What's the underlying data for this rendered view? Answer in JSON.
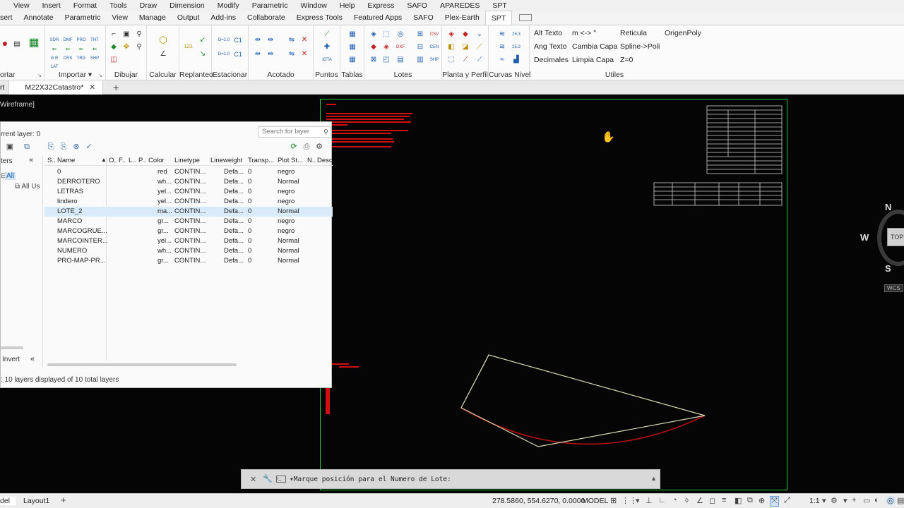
{
  "menubar": [
    "View",
    "Insert",
    "Format",
    "Tools",
    "Draw",
    "Dimension",
    "Modify",
    "Parametric",
    "Window",
    "Help",
    "Express",
    "SAFO",
    "APAREDES",
    "SPT"
  ],
  "ribbon_tabs": [
    "sert",
    "Annotate",
    "Parametric",
    "View",
    "Manage",
    "Output",
    "Add-ins",
    "Collaborate",
    "Express Tools",
    "Featured Apps",
    "SAFO",
    "Plex-Earth",
    "SPT"
  ],
  "ribbon_active_tab": "SPT",
  "ribbon_panels": {
    "p0": "ortar",
    "p1": "Importar",
    "p2": "Dibujar",
    "p3": "Calcular",
    "p4": "Replanteo",
    "p5": "Estacionar",
    "p6": "Acotado",
    "p7": "Puntos",
    "p8": "Tablas",
    "p9": "Lotes",
    "p10": "Planta y Perfil",
    "p11": "Curvas Nivel",
    "p12": "Utiles"
  },
  "ribbon_text_buttons": {
    "alt_texto": "Alt Texto",
    "ang_texto": "Ang Texto",
    "decimales": "Decimales",
    "m_swap": "m <-> \"",
    "cambia_capa": "Cambia Capa",
    "limpia_capa": "Limpia Capa",
    "reticula": "Reticula",
    "spline_poli": "Spline->Poli",
    "z0": "Z=0",
    "origen_poly": "OrigenPoly"
  },
  "ribbon_icon_labels": {
    "sdr": "SDR",
    "dmf": "DMF",
    "pro": "PRO",
    "tht": "THT",
    "gr": "G R",
    "lat": "LAT",
    "crs": "CRS",
    "trg": "TRG",
    "shp": "SHP",
    "n123": "123.",
    "ds1": "D=1.0",
    "ds2": "D=1.0",
    "c1a": "C1",
    "c1b": "C1",
    "csv": "CSV",
    "dxf": "DXF",
    "cen": "CEN",
    "shp2": "SHP",
    "n25": "25.3",
    "n25b": "25.3",
    "iota": "IOTA"
  },
  "file_tab": {
    "left_stub": "rt",
    "active": "M22X32Catastro*"
  },
  "viewport_label": "Wireframe]",
  "layers_panel": {
    "current_layer": "rrent layer: 0",
    "search_placeholder": "Search for layer",
    "filters_header": "ters",
    "filter_all": "All",
    "filter_all_used": "All Us",
    "invert": "Invert",
    "status": ": 10 layers displayed of 10 total layers",
    "columns": [
      "S..",
      "Name",
      "O..",
      "F..",
      "L..",
      "P..",
      "Color",
      "Linetype",
      "Lineweight",
      "Transp...",
      "Plot St...",
      "N..",
      "Desc"
    ],
    "rows": [
      {
        "name": "0",
        "color": "red",
        "color_hex": "#e01515",
        "linetype": "CONTIN...",
        "lineweight": "Defa...",
        "transp": "0",
        "plot": "negro",
        "current": true,
        "selected": false
      },
      {
        "name": "DERROTERO",
        "color": "wh...",
        "color_hex": "#ffffff",
        "linetype": "CONTIN...",
        "lineweight": "Defa...",
        "transp": "0",
        "plot": "Normal",
        "current": false,
        "selected": false
      },
      {
        "name": "LETRAS",
        "color": "yel...",
        "color_hex": "#f5f01a",
        "linetype": "CONTIN...",
        "lineweight": "Defa...",
        "transp": "0",
        "plot": "negro",
        "current": false,
        "selected": false
      },
      {
        "name": "lindero",
        "color": "yel...",
        "color_hex": "#f5f01a",
        "linetype": "CONTIN...",
        "lineweight": "Defa...",
        "transp": "0",
        "plot": "negro",
        "current": false,
        "selected": false
      },
      {
        "name": "LOTE_2",
        "color": "ma...",
        "color_hex": "#e020e0",
        "linetype": "CONTIN...",
        "lineweight": "Defa...",
        "transp": "0",
        "plot": "Normal",
        "current": false,
        "selected": true
      },
      {
        "name": "MARCO",
        "color": "gr...",
        "color_hex": "#22c83a",
        "linetype": "CONTIN...",
        "lineweight": "Defa...",
        "transp": "0",
        "plot": "negro",
        "current": false,
        "selected": false
      },
      {
        "name": "MARCOGRUE...",
        "color": "gr...",
        "color_hex": "#22c83a",
        "linetype": "CONTIN...",
        "lineweight": "Defa...",
        "transp": "0",
        "plot": "negro",
        "current": false,
        "selected": false
      },
      {
        "name": "MARCOINTER...",
        "color": "yel...",
        "color_hex": "#f5f01a",
        "linetype": "CONTIN...",
        "lineweight": "Defa...",
        "transp": "0",
        "plot": "Normal",
        "current": false,
        "selected": false
      },
      {
        "name": "NUMERO",
        "color": "wh...",
        "color_hex": "#ffffff",
        "linetype": "CONTIN...",
        "lineweight": "Defa...",
        "transp": "0",
        "plot": "Normal",
        "current": false,
        "selected": false
      },
      {
        "name": "PRO-MAP-PR...",
        "color": "gr...",
        "color_hex": "#22c83a",
        "linetype": "CONTIN...",
        "lineweight": "Defa...",
        "transp": "0",
        "plot": "Normal",
        "current": false,
        "selected": false
      }
    ]
  },
  "command_line": {
    "prompt": "Marque posición para el Numero de Lote:"
  },
  "status_bar": {
    "model_tab": "del",
    "layout_tab": "Layout1",
    "coordinates": "278.5860, 554.6270, 0.0000",
    "model": "MODEL",
    "scale": "1:1"
  },
  "viewcube": {
    "north": "N",
    "west": "W",
    "south": "S",
    "top": "TOP",
    "wcs": "WCS"
  },
  "colors": {
    "sheet_border": "#22c83a",
    "red_text": "#d01010",
    "polyline": "#d8d8b0",
    "arc": "#b01010"
  }
}
